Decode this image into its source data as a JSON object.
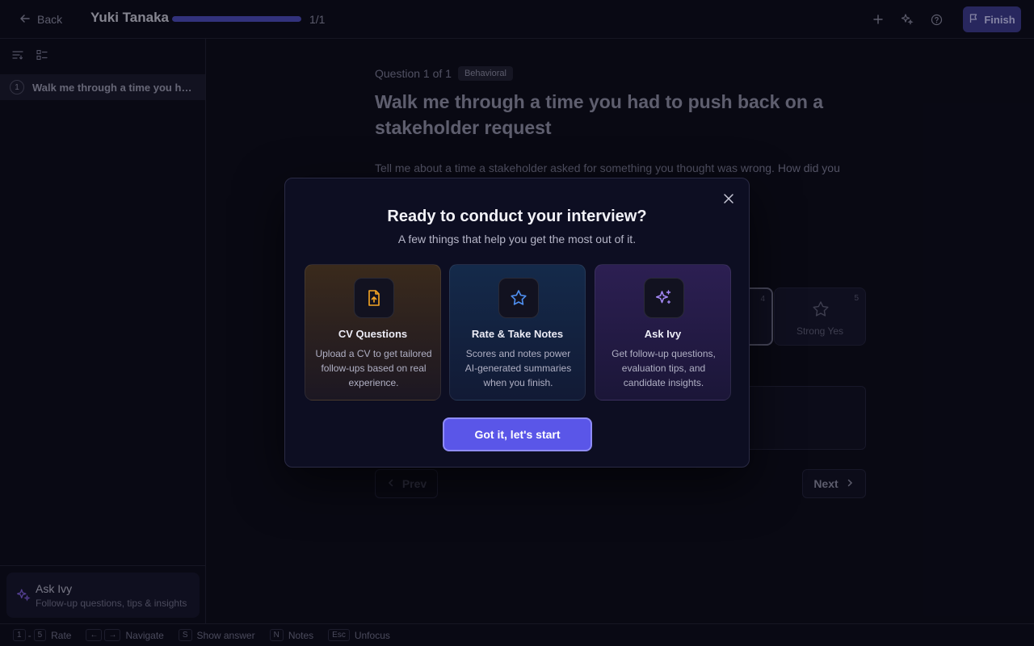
{
  "header": {
    "back_label": "Back",
    "candidate_name": "Yuki Tanaka",
    "progress_fraction": 1.0,
    "progress_text": "1/1",
    "finish_label": "Finish"
  },
  "sidebar": {
    "questions": [
      {
        "number": "1",
        "title": "Walk me through a time you had to push back on a stakeholder request"
      }
    ],
    "ask_ivy": {
      "title": "Ask Ivy",
      "subtitle": "Follow-up questions, tips & insights"
    }
  },
  "main": {
    "counter": "Question 1 of 1",
    "badge": "Behavioral",
    "heading": "Walk me through a time you had to push back on a stakeholder request",
    "description": "Tell me about a time a stakeholder asked for something you thought was wrong. How did you",
    "ratings": [
      {
        "number": "4",
        "label": ""
      },
      {
        "number": "5",
        "label": "Strong Yes"
      }
    ],
    "prev_label": "Prev",
    "next_label": "Next"
  },
  "footer": {
    "hints": [
      {
        "keys": [
          "1",
          "5"
        ],
        "sep": "-",
        "label": "Rate"
      },
      {
        "keys": [
          "←",
          "→"
        ],
        "sep": "",
        "label": "Navigate"
      },
      {
        "keys": [
          "S"
        ],
        "sep": "",
        "label": "Show answer"
      },
      {
        "keys": [
          "N"
        ],
        "sep": "",
        "label": "Notes"
      },
      {
        "keys": [
          "Esc"
        ],
        "sep": "",
        "label": "Unfocus"
      }
    ]
  },
  "modal": {
    "title": "Ready to conduct your interview?",
    "subtitle": "A few things that help you get the most out of it.",
    "features": [
      {
        "icon": "file-upload-icon",
        "title": "CV Questions",
        "description": "Upload a CV to get tailored follow-ups based on real experience.",
        "accent": "#f5a524"
      },
      {
        "icon": "star-icon",
        "title": "Rate & Take Notes",
        "description": "Scores and notes power AI-generated summaries when you finish.",
        "accent": "#4f8ff0"
      },
      {
        "icon": "sparkles-icon",
        "title": "Ask Ivy",
        "description": "Get follow-up questions, evaluation tips, and candidate insights.",
        "accent": "#a78bfa"
      }
    ],
    "start_label": "Got it, let's start"
  },
  "colors": {
    "accent": "#5a56e8",
    "background": "#0b0b18"
  }
}
